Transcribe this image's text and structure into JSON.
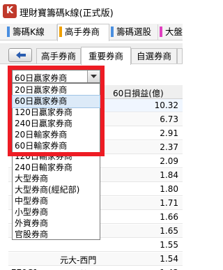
{
  "app": {
    "icon_letter": "K",
    "title": "理財寶籌碼k線(正式版)"
  },
  "top_tabs": [
    {
      "label": "籌碼K線",
      "color": "#4a8fe0"
    },
    {
      "label": "高手券商",
      "color": "#f0a000"
    },
    {
      "label": "籌碼選股",
      "color": "#4a8fe0"
    },
    {
      "label": "大盤",
      "color": "#e040c0"
    }
  ],
  "sub_tabs": [
    "高手券商",
    "重要券商",
    "自選券商"
  ],
  "dropdown": {
    "selected": "60日贏家券商",
    "options": [
      "20日贏家券商",
      "60日贏家券商",
      "120日贏家券商",
      "240日贏家券商",
      "20日輸家券商",
      "60日輸家券商",
      "120日輸家券商",
      "240日輸家券商",
      "大型券商",
      "大型券商(經紀部)",
      "中型券商",
      "小型券商",
      "外資券商",
      "官股券商"
    ]
  },
  "table": {
    "column_header_value": "60日損益(億)",
    "rows": [
      {
        "code": "",
        "name": "",
        "value": "10.32"
      },
      {
        "code": "",
        "name": "",
        "value": "6.73"
      },
      {
        "code": "",
        "name": "",
        "value": "2.91"
      },
      {
        "code": "",
        "name": "",
        "value": "2.37"
      },
      {
        "code": "",
        "name": "",
        "value": "2.09"
      },
      {
        "code": "",
        "name": "",
        "value": "1.84"
      },
      {
        "code": "",
        "name": "",
        "value": "1.80"
      },
      {
        "code": "",
        "name": "",
        "value": "1.71"
      },
      {
        "code": "",
        "name": "",
        "value": "1.66"
      },
      {
        "code": "",
        "name": "",
        "value": "1.65"
      },
      {
        "code": "",
        "name": "",
        "value": "1.55"
      },
      {
        "code": "",
        "name": "",
        "value": "1.54"
      },
      {
        "code": "779C1",
        "name": "國票-敦北",
        "value": "1.43"
      }
    ],
    "partial_row_name": "元大-西門"
  }
}
